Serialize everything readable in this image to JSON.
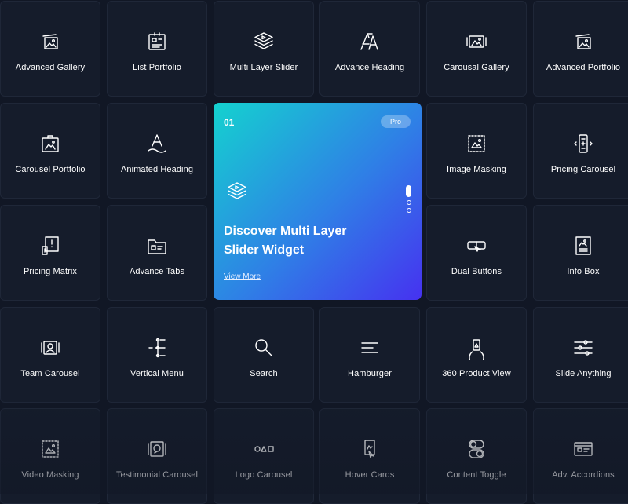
{
  "rows": [
    [
      {
        "label": "Advanced Gallery",
        "icon": "gallery-icon"
      },
      {
        "label": "List Portfolio",
        "icon": "list-portfolio-icon"
      },
      {
        "label": "Multi Layer Slider",
        "icon": "layers-icon"
      },
      {
        "label": "Advance Heading",
        "icon": "heading-icon"
      },
      {
        "label": "Carousal Gallery",
        "icon": "carousel-gallery-icon"
      },
      {
        "label": "Advanced Portfolio",
        "icon": "portfolio-icon"
      }
    ],
    [
      {
        "label": "Carousel Portfolio",
        "icon": "carousel-portfolio-icon"
      },
      {
        "label": "Animated Heading",
        "icon": "animated-heading-icon"
      },
      {
        "label": "Image Masking",
        "icon": "image-masking-icon"
      },
      {
        "label": "Pricing Carousel",
        "icon": "pricing-carousel-icon"
      }
    ],
    [
      {
        "label": "Pricing Matrix",
        "icon": "pricing-matrix-icon"
      },
      {
        "label": "Advance Tabs",
        "icon": "tabs-icon"
      },
      {
        "label": "Dual Buttons",
        "icon": "dual-buttons-icon"
      },
      {
        "label": "Info Box",
        "icon": "info-box-icon"
      }
    ],
    [
      {
        "label": "Team Carousel",
        "icon": "team-carousel-icon"
      },
      {
        "label": "Vertical Menu",
        "icon": "vertical-menu-icon"
      },
      {
        "label": "Search",
        "icon": "search-icon"
      },
      {
        "label": "Hamburger",
        "icon": "hamburger-icon"
      },
      {
        "label": "360 Product View",
        "icon": "product-view-icon"
      },
      {
        "label": "Slide Anything",
        "icon": "sliders-icon"
      }
    ],
    [
      {
        "label": "Video Masking",
        "icon": "video-masking-icon"
      },
      {
        "label": "Testimonial Carousel",
        "icon": "testimonial-icon"
      },
      {
        "label": "Logo Carousel",
        "icon": "logo-carousel-icon"
      },
      {
        "label": "Hover Cards",
        "icon": "hover-cards-icon"
      },
      {
        "label": "Content Toggle",
        "icon": "toggle-icon"
      },
      {
        "label": "Adv. Accordions",
        "icon": "accordion-icon"
      }
    ]
  ],
  "featured": {
    "number": "01",
    "badge": "Pro",
    "title_line1": "Discover Multi Layer",
    "title_line2": "Slider Widget",
    "link": "View More",
    "icon": "layers-icon",
    "slides": 3,
    "active_slide": 1
  },
  "colors": {
    "background": "#111725",
    "tile": "#151c2b",
    "gradient_start": "#14d2cf",
    "gradient_end": "#4632f0"
  }
}
